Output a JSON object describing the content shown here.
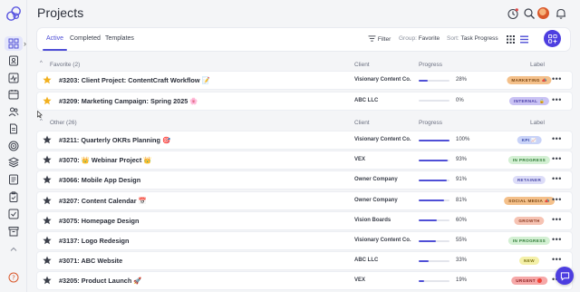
{
  "header": {
    "title": "Projects"
  },
  "tabs": [
    {
      "label": "Active",
      "active": true
    },
    {
      "label": "Completed",
      "active": false
    },
    {
      "label": "Templates",
      "active": false
    }
  ],
  "toolbar": {
    "filter_label": "Filter",
    "group_prefix": "Group:",
    "group_value": "Favorite",
    "sort_prefix": "Sort:",
    "sort_value": "Task Progress"
  },
  "columns": {
    "client": "Client",
    "progress": "Progress",
    "label": "Label"
  },
  "groups": [
    {
      "name": "Favorite (2)",
      "favorite": true,
      "rows": [
        {
          "title": "#3203: Client Project: ContentCraft Workflow 📝",
          "client": "Visionary Content Co.",
          "progress": 28,
          "progress_text": "28%",
          "label": "MARKETING 📣",
          "label_bg": "#f4c08a",
          "label_fg": "#7a4512"
        },
        {
          "title": "#3209: Marketing Campaign: Spring 2025 🌸",
          "client": "ABC LLC",
          "progress": 0,
          "progress_text": "0%",
          "label": "INTERNAL 🔒",
          "label_bg": "#c9c2f4",
          "label_fg": "#4b3fa8"
        }
      ]
    },
    {
      "name": "Other (26)",
      "favorite": false,
      "rows": [
        {
          "title": "#3211: Quarterly OKRs Planning 🎯",
          "client": "Visionary Content Co.",
          "progress": 100,
          "progress_text": "100%",
          "label": "KPI 📈",
          "label_bg": "#c9d3f8",
          "label_fg": "#3a4aa8"
        },
        {
          "title": "#3070: 👑 Webinar Project 👑",
          "client": "VEX",
          "progress": 93,
          "progress_text": "93%",
          "label": "IN PROGRESS",
          "label_bg": "#d3f0d3",
          "label_fg": "#2f7a36"
        },
        {
          "title": "#3066: Mobile App Design",
          "client": "Owner Company",
          "progress": 91,
          "progress_text": "91%",
          "label": "RETAINER",
          "label_bg": "#dcdcf8",
          "label_fg": "#4a4aa8"
        },
        {
          "title": "#3207: Content Calendar 📅",
          "client": "Owner Company",
          "progress": 81,
          "progress_text": "81%",
          "label": "SOCIAL MEDIA 📣",
          "label_bg": "#f4c08a",
          "label_fg": "#7a4512"
        },
        {
          "title": "#3075: Homepage Design",
          "client": "Vision Boards",
          "progress": 60,
          "progress_text": "60%",
          "label": "GROWTH",
          "label_bg": "#f6c3b3",
          "label_fg": "#8a3a22"
        },
        {
          "title": "#3137: Logo Redesign",
          "client": "Visionary Content Co.",
          "progress": 55,
          "progress_text": "55%",
          "label": "IN PROGRESS",
          "label_bg": "#d3f0d3",
          "label_fg": "#2f7a36"
        },
        {
          "title": "#3071: ABC Website",
          "client": "ABC LLC",
          "progress": 33,
          "progress_text": "33%",
          "label": "NEW",
          "label_bg": "#f4f0a8",
          "label_fg": "#7a7012"
        },
        {
          "title": "#3205: Product Launch 🚀",
          "client": "VEX",
          "progress": 19,
          "progress_text": "19%",
          "label": "URGENT 🔴",
          "label_bg": "#f6a8a8",
          "label_fg": "#8a1f1f"
        }
      ]
    }
  ],
  "icons": {
    "sidebar": [
      "dashboard-icon",
      "contacts-icon",
      "activity-icon",
      "calendar-icon",
      "team-icon",
      "documents-icon",
      "goals-icon",
      "layers-icon",
      "tasks-icon",
      "checklist-icon",
      "settings-icon",
      "archive-icon",
      "help-icon"
    ],
    "header": [
      "timer-icon",
      "search-icon",
      "avatar",
      "notification-bell-icon"
    ]
  },
  "colors": {
    "accent": "#4f4fd6",
    "fab": "#4d3ee0",
    "star_favorite": "#f2b01e",
    "star_default": "#3b3f4a"
  }
}
